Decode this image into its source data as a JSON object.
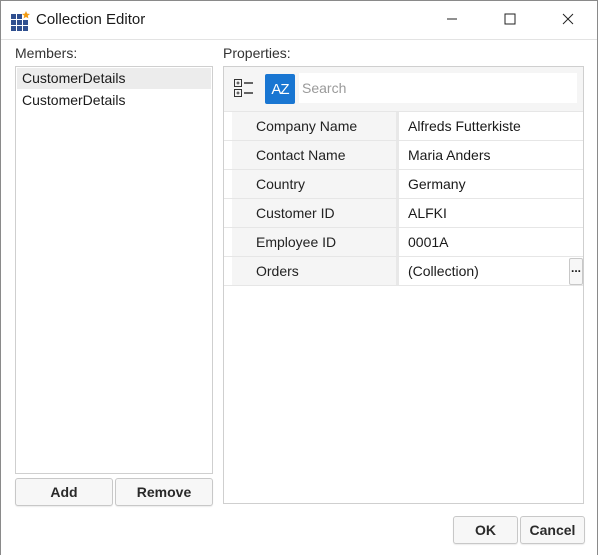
{
  "window": {
    "title": "Collection Editor",
    "icon": "grid-app-icon",
    "controls": [
      "minimize-icon",
      "maximize-icon",
      "close-icon"
    ]
  },
  "members": {
    "label": "Members:",
    "items": [
      "CustomerDetails",
      "CustomerDetails"
    ],
    "selected_index": 0,
    "add_label": "Add",
    "remove_label": "Remove"
  },
  "properties": {
    "label": "Properties:",
    "toolbar": {
      "categorize_icon": "categorized-view-icon",
      "sort_icon": "alphabetical-sort-icon",
      "sort_text": "AZ",
      "search_placeholder": "Search",
      "search_value": ""
    },
    "rows": [
      {
        "name": "Company Name",
        "value": "Alfreds Futterkiste"
      },
      {
        "name": "Contact Name",
        "value": "Maria Anders"
      },
      {
        "name": "Country",
        "value": "Germany"
      },
      {
        "name": "Customer ID",
        "value": "ALFKI"
      },
      {
        "name": "Employee ID",
        "value": "0001A"
      },
      {
        "name": "Orders",
        "value": "(Collection)",
        "editor": "..."
      }
    ]
  },
  "footer": {
    "ok_label": "OK",
    "cancel_label": "Cancel"
  },
  "colors": {
    "accent": "#1976d2",
    "icon_orange": "#f39c12",
    "icon_navy": "#2f4f8f"
  }
}
